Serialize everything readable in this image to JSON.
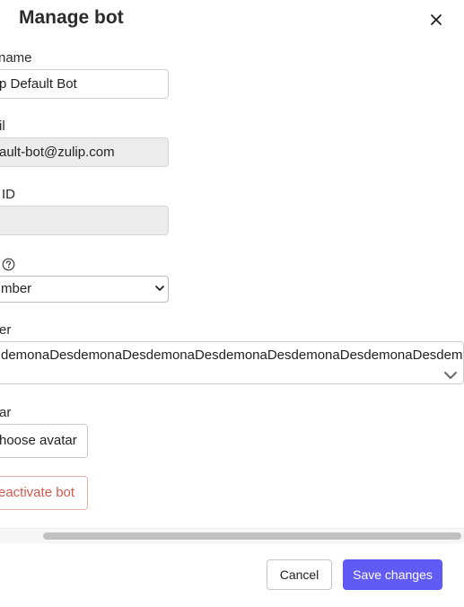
{
  "modal": {
    "title": "Manage bot",
    "close_icon": "close-icon"
  },
  "fields": {
    "name": {
      "label": "name",
      "value": "p Default Bot"
    },
    "email": {
      "label": "il",
      "value": "ault-bot@zulip.com"
    },
    "user_id": {
      "label": "ID",
      "value": ""
    },
    "role": {
      "label": "",
      "help_icon": "question-circle-icon",
      "selected": "mber",
      "chevron_icon": "chevron-down-icon"
    },
    "owner": {
      "label": "er",
      "value": "demonaDesdemonaDesdemonaDesdemonaDesdemonaDesdemonaDesdem",
      "chevron_icon": "chevron-down-icon"
    },
    "avatar": {
      "label": "ar",
      "button_label": "hoose avatar"
    }
  },
  "actions": {
    "deactivate_label": "eactivate bot",
    "cancel_label": "Cancel",
    "save_label": "Save changes"
  },
  "colors": {
    "primary": "#615bf6",
    "danger": "#d15b4f",
    "readonly_bg": "#ececec"
  }
}
